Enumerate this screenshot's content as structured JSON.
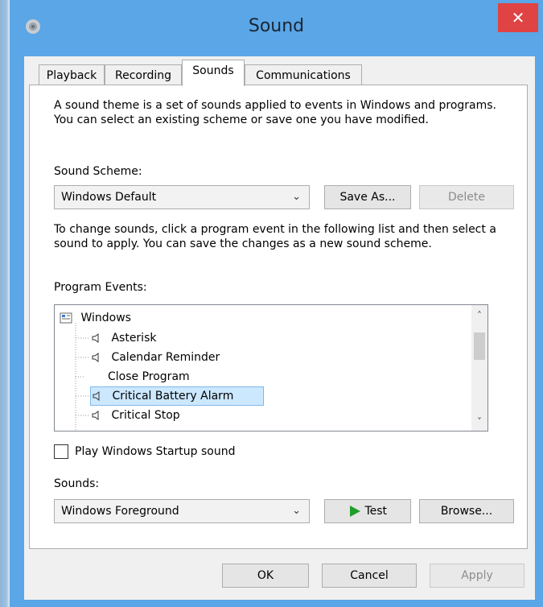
{
  "window": {
    "title": "Sound",
    "close_glyph": "✕"
  },
  "tabs": [
    {
      "label": "Playback"
    },
    {
      "label": "Recording"
    },
    {
      "label": "Sounds"
    },
    {
      "label": "Communications"
    }
  ],
  "sounds_tab": {
    "intro": "A sound theme is a set of sounds applied to events in Windows and programs.  You can select an existing scheme or save one you have modified.",
    "scheme_label": "Sound Scheme:",
    "scheme_value": "Windows Default",
    "save_as_label": "Save As...",
    "delete_label": "Delete",
    "change_text": "To change sounds, click a program event in the following list and then select a sound to apply.  You can save the changes as a new sound scheme.",
    "events_label": "Program Events:",
    "events": {
      "root": "Windows",
      "items": [
        {
          "label": "Asterisk",
          "has_sound": true
        },
        {
          "label": "Calendar Reminder",
          "has_sound": true
        },
        {
          "label": "Close Program",
          "has_sound": false
        },
        {
          "label": "Critical Battery Alarm",
          "has_sound": true,
          "selected": true
        },
        {
          "label": "Critical Stop",
          "has_sound": true
        }
      ]
    },
    "startup_label": "Play Windows Startup sound",
    "startup_checked": false,
    "sounds_label": "Sounds:",
    "sound_value": "Windows Foreground",
    "test_label": "Test",
    "browse_label": "Browse..."
  },
  "footer": {
    "ok_label": "OK",
    "cancel_label": "Cancel",
    "apply_label": "Apply"
  },
  "colors": {
    "titlebar": "#5aa6e6",
    "close": "#e04343",
    "selection": "#cce8ff",
    "test_icon": "#1f9e2a"
  }
}
